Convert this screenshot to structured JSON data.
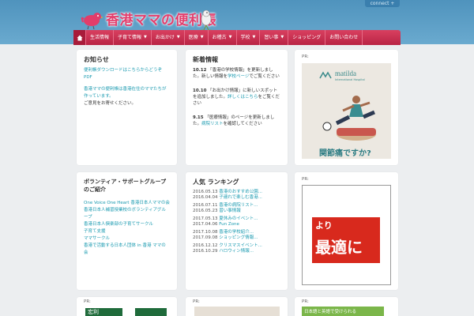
{
  "header": {
    "site_title": "香港ママの便利帳",
    "connect_label": "connect",
    "connect_icon": "plus-icon"
  },
  "nav": {
    "home_icon": "home-icon",
    "items": [
      {
        "label": "生活情報",
        "has_dropdown": false
      },
      {
        "label": "子育て情報",
        "has_dropdown": true
      },
      {
        "label": "お出かけ",
        "has_dropdown": true
      },
      {
        "label": "医療",
        "has_dropdown": true
      },
      {
        "label": "お稽古",
        "has_dropdown": true
      },
      {
        "label": "学校",
        "has_dropdown": true
      },
      {
        "label": "習い事",
        "has_dropdown": true
      },
      {
        "label": "ショッピング",
        "has_dropdown": false
      },
      {
        "label": "お問い合わせ",
        "has_dropdown": false
      }
    ]
  },
  "panels": {
    "info": {
      "title": "お知らせ",
      "link1": "便利帳ダウンロードはこちらからどうぞ PDF",
      "link2": "香港ママの便利帳は香港在住のママたちが作っています。",
      "text2": "ご意見をお寄せください。"
    },
    "news": {
      "title": "新着情報",
      "items": [
        {
          "date": "10.12",
          "text": "「香港の学校情報」を更新しました。新しい情報を",
          "link": "学校ページ",
          "tail": "でご覧ください"
        },
        {
          "date": "10.10",
          "text": "「お出かけ情報」に新しいスポットを追加しました。",
          "link": "詳しくはこちら",
          "tail": "をご覧ください"
        },
        {
          "date": "9.15",
          "text": "「医療情報」のページを更新しました。",
          "link": "病院リスト",
          "tail": "を確認してください"
        }
      ]
    },
    "ad1": {
      "pr": "PR:",
      "brand": "matilda",
      "brand_sub": "International Hospital",
      "tagline": "関節痛ですか?"
    },
    "volunteer": {
      "title": "ボランティア・サポートグループのご紹介",
      "links": [
        "One Voice One Heart 香港日本人ママの会",
        "香港日本人補習授業校のボランティアグループ",
        "香港日本人倶楽部の子育てサークル",
        "子育て支援",
        "ママサークル",
        "香港で活動する日本人団体 in 香港 ママの会"
      ]
    },
    "ranking": {
      "title": "人気 ランキング",
      "groups": [
        {
          "rows": [
            {
              "date": "2016.05.13",
              "text": "香港のおすすめ公園..."
            },
            {
              "date": "2016.04.04",
              "text": "子連れで楽しむ香港..."
            }
          ]
        },
        {
          "rows": [
            {
              "date": "2016.07.11",
              "text": "香港の病院リスト..."
            },
            {
              "date": "2016.05.23",
              "text": "習い事情報"
            }
          ]
        },
        {
          "rows": [
            {
              "date": "2017.05.13",
              "text": "夏休みのイベント..."
            },
            {
              "date": "2017.04.06",
              "text": "Fun Zone"
            }
          ]
        },
        {
          "rows": [
            {
              "date": "2017.10.08",
              "text": "香港の学校紹介..."
            },
            {
              "date": "2017.09.08",
              "text": "ショッピング情報..."
            }
          ]
        },
        {
          "rows": [
            {
              "date": "2016.12.12",
              "text": "クリスマスイベント..."
            },
            {
              "date": "2016.10.29",
              "text": "ハロウィン情報..."
            }
          ]
        }
      ]
    },
    "ad2": {
      "pr": "PR:",
      "line1": "より",
      "line2": "最適に"
    },
    "bottom": [
      {
        "pr": "PR:",
        "brand": "宏利"
      },
      {
        "pr": "PR:"
      },
      {
        "pr": "PR:",
        "brand": "日本語と英語で受けられる"
      }
    ]
  },
  "colors": {
    "nav_bg": "#c62f50",
    "link": "#1a9ab0",
    "logo": "#e33f6d",
    "header_bg": "#5a9dc6"
  }
}
